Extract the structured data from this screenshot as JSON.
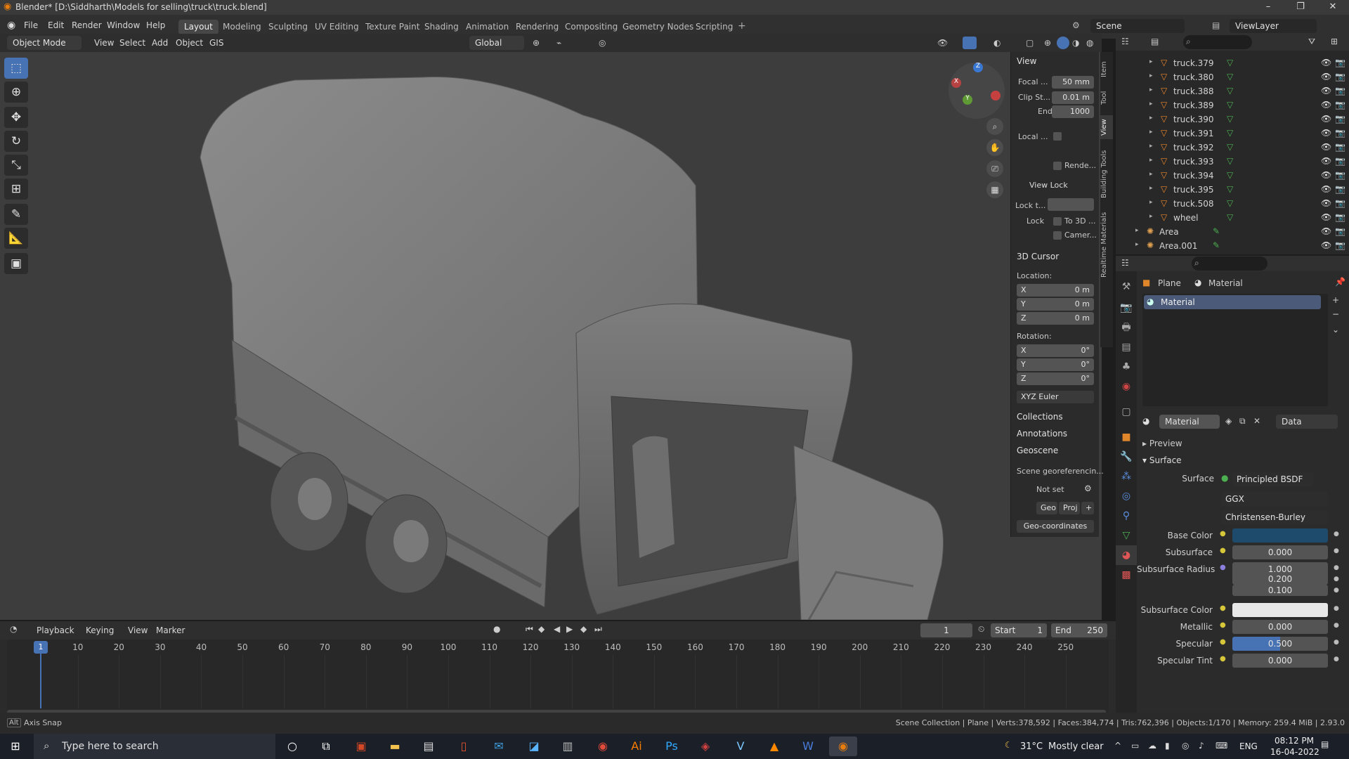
{
  "title": "Blender* [D:\\Siddharth\\Models for selling\\truck\\truck.blend]",
  "menu": [
    "File",
    "Edit",
    "Render",
    "Window",
    "Help"
  ],
  "workspaces": [
    "Layout",
    "Modeling",
    "Sculpting",
    "UV Editing",
    "Texture Paint",
    "Shading",
    "Animation",
    "Rendering",
    "Compositing",
    "Geometry Nodes",
    "Scripting"
  ],
  "scene": "Scene",
  "view_layer": "ViewLayer",
  "header3d": {
    "mode": "Object Mode",
    "view": "View",
    "select": "Select",
    "add": "Add",
    "object": "Object",
    "gis": "GIS",
    "transform": "Global"
  },
  "npanel": {
    "view_header": "View",
    "focal_label": "Focal ...",
    "focal": "50 mm",
    "clip_label": "Clip St...",
    "clip": "0.01 m",
    "end_label": "End",
    "end": "1000",
    "local_label": "Local ...",
    "render_label": "Rende...",
    "viewlock": "View Lock",
    "lock_to_label": "Lock t...",
    "lock_label": "Lock",
    "to3d": "To 3D ...",
    "camera": "Camer...",
    "cursor_header": "3D Cursor",
    "location": "Location:",
    "rotation": "Rotation:",
    "x": "X",
    "y": "Y",
    "z": "Z",
    "loc_val": "0 m",
    "rot_val": "0°",
    "euler": "XYZ Euler",
    "collections": "Collections",
    "annotations": "Annotations",
    "geoscene": "Geoscene",
    "geo_ref": "Scene georeferencin...",
    "not_set": "Not set",
    "geo": "Geo",
    "proj": "Proj",
    "geo_coords": "Geo-coordinates"
  },
  "vtabs": [
    "Item",
    "Tool",
    "View",
    "Building Tools",
    "Realtime Materials"
  ],
  "outliner": [
    "truck.379",
    "truck.380",
    "truck.388",
    "truck.389",
    "truck.390",
    "truck.391",
    "truck.392",
    "truck.393",
    "truck.394",
    "truck.395",
    "truck.508",
    "wheel",
    "Area",
    "Area.001"
  ],
  "props": {
    "object": "Plane",
    "material_tab": "Material",
    "slot": "Material",
    "mat_name": "Material",
    "link": "Data",
    "preview": "Preview",
    "surface_section": "Surface",
    "surface_label": "Surface",
    "surface": "Principled BSDF",
    "dist": "GGX",
    "sss_method": "Christensen-Burley",
    "rows": [
      {
        "label": "Base Color",
        "value": ""
      },
      {
        "label": "Subsurface",
        "value": "0.000"
      },
      {
        "label": "Subsurface Radius",
        "value": "1.000"
      },
      {
        "label": "",
        "value": "0.200"
      },
      {
        "label": "",
        "value": "0.100"
      },
      {
        "label": "Subsurface Color",
        "value": ""
      },
      {
        "label": "Metallic",
        "value": "0.000"
      },
      {
        "label": "Specular",
        "value": "0.500"
      },
      {
        "label": "Specular Tint",
        "value": "0.000"
      }
    ],
    "specular_fill": 0.5
  },
  "timeline": {
    "playback": "Playback",
    "keying": "Keying",
    "view": "View",
    "marker": "Marker",
    "frame": "1",
    "start_label": "Start",
    "start": "1",
    "end_label": "End",
    "end": "250",
    "ticks": [
      "1",
      "10",
      "20",
      "30",
      "40",
      "50",
      "60",
      "70",
      "80",
      "90",
      "100",
      "110",
      "120",
      "130",
      "140",
      "150",
      "160",
      "170",
      "180",
      "190",
      "200",
      "210",
      "220",
      "230",
      "240",
      "250"
    ]
  },
  "status": {
    "left": "Axis Snap",
    "right": "Scene Collection | Plane | Verts:378,592 | Faces:384,774 | Tris:762,396 | Objects:1/170 | Memory: 259.4 MiB | 2.93.0"
  },
  "taskbar": {
    "search": "Type here to search",
    "temp": "31°C",
    "weather": "Mostly clear",
    "lang": "ENG",
    "time": "08:12 PM",
    "date": "16-04-2022"
  },
  "colors": {
    "accent": "#4772b3",
    "base_color": "#1e4a6b",
    "subsurface_color": "#e8e8e8"
  }
}
